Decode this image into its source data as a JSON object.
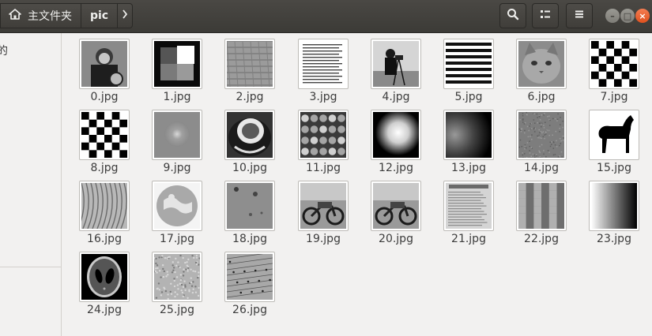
{
  "header": {
    "home_label": "主文件夹",
    "current_folder": "pic",
    "home_icon": "home-icon",
    "next_icon": "chevron-right-icon",
    "search_icon": "search-icon",
    "view_icon": "view-options-icon",
    "menu_icon": "hamburger-menu-icon"
  },
  "sidebar": {
    "item_fragment": "的"
  },
  "files": [
    {
      "name": "0.jpg",
      "thumb": "portrait-photo"
    },
    {
      "name": "1.jpg",
      "thumb": "gray-squares"
    },
    {
      "name": "2.jpg",
      "thumb": "brick-texture"
    },
    {
      "name": "3.jpg",
      "thumb": "text-document"
    },
    {
      "name": "4.jpg",
      "thumb": "cameraman"
    },
    {
      "name": "5.jpg",
      "thumb": "horizontal-stripes"
    },
    {
      "name": "6.jpg",
      "thumb": "cat"
    },
    {
      "name": "7.jpg",
      "thumb": "checkerboard"
    },
    {
      "name": "8.jpg",
      "thumb": "checkerboard"
    },
    {
      "name": "9.jpg",
      "thumb": "blurred-circle"
    },
    {
      "name": "10.jpg",
      "thumb": "coffee-cup"
    },
    {
      "name": "11.jpg",
      "thumb": "coins"
    },
    {
      "name": "12.jpg",
      "thumb": "glow-blob"
    },
    {
      "name": "13.jpg",
      "thumb": "glow-fade"
    },
    {
      "name": "14.jpg",
      "thumb": "noise"
    },
    {
      "name": "15.jpg",
      "thumb": "horse-silhouette"
    },
    {
      "name": "16.jpg",
      "thumb": "cell-texture"
    },
    {
      "name": "17.jpg",
      "thumb": "round-puzzle"
    },
    {
      "name": "18.jpg",
      "thumb": "gray-spots"
    },
    {
      "name": "19.jpg",
      "thumb": "motorcycles"
    },
    {
      "name": "20.jpg",
      "thumb": "motorcycles"
    },
    {
      "name": "21.jpg",
      "thumb": "page-scan"
    },
    {
      "name": "22.jpg",
      "thumb": "pixel-blocks"
    },
    {
      "name": "23.jpg",
      "thumb": "gradient"
    },
    {
      "name": "24.jpg",
      "thumb": "phantom"
    },
    {
      "name": "25.jpg",
      "thumb": "rough-texture"
    },
    {
      "name": "26.jpg",
      "thumb": "sheet-music"
    }
  ],
  "colors": {
    "headerbar": "#3c3b37",
    "background": "#f2f1f0",
    "close_button": "#e0511e"
  }
}
